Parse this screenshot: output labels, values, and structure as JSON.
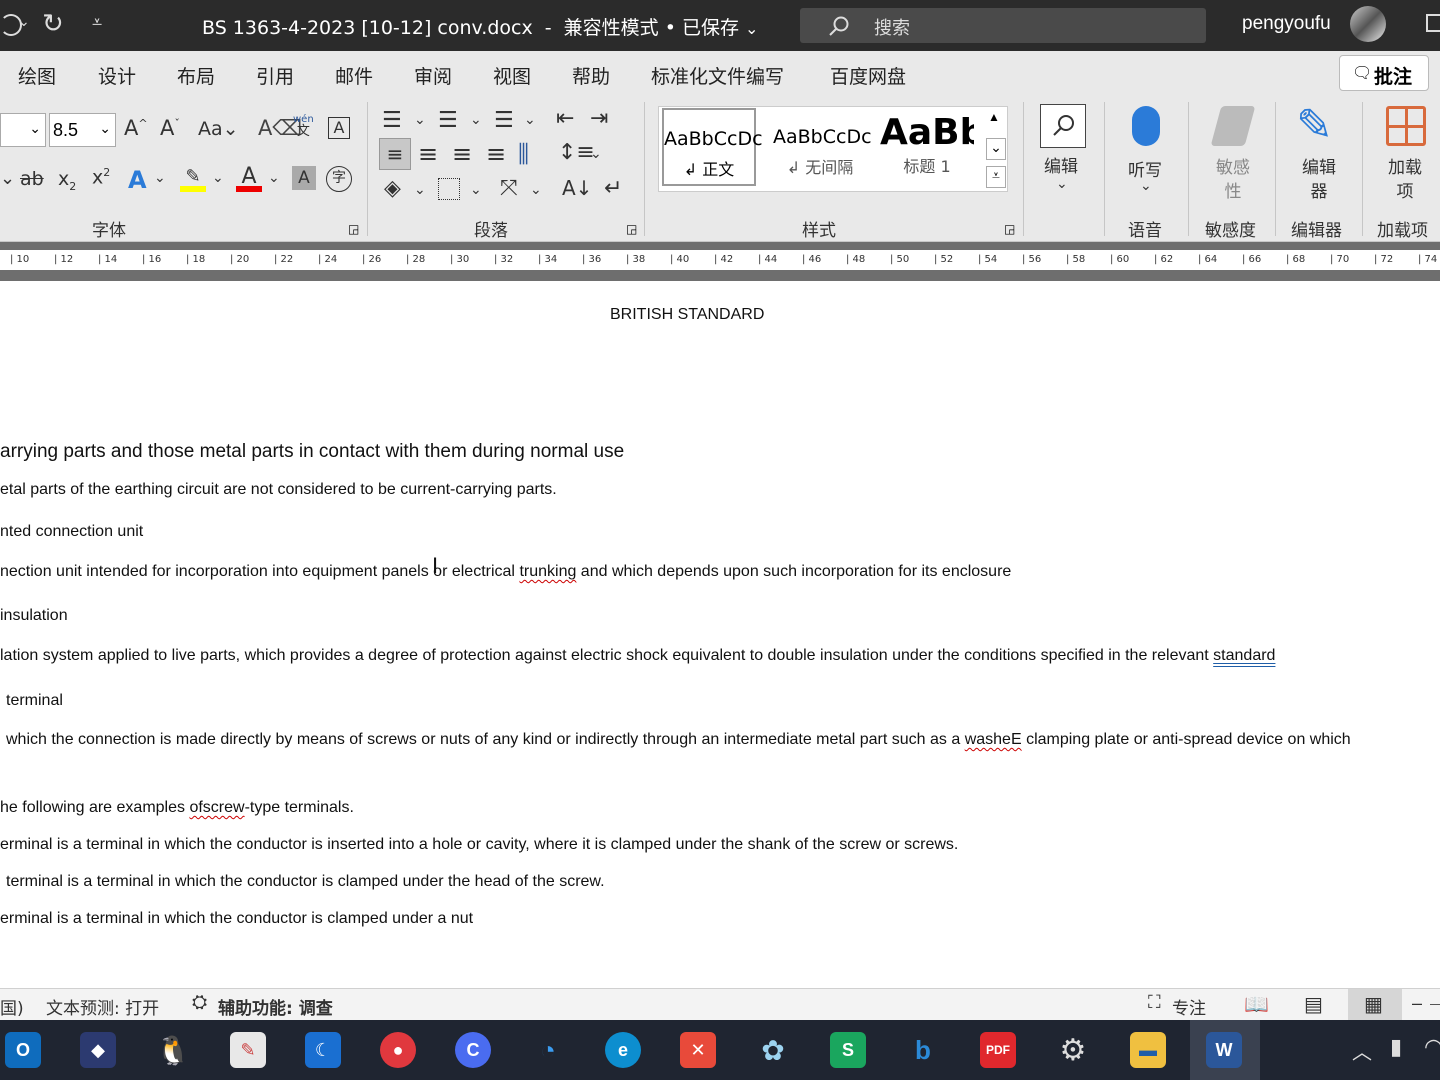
{
  "titlebar": {
    "doc_title": "BS 1363-4-2023 [10-12] conv.docx",
    "dash": "-",
    "mode": "兼容性模式 • 已保存",
    "search_placeholder": "搜索",
    "user": "pengyoufu"
  },
  "tabs": [
    "绘图",
    "设计",
    "布局",
    "引用",
    "邮件",
    "审阅",
    "视图",
    "帮助",
    "标准化文件编写",
    "百度网盘"
  ],
  "comment_button": "批注",
  "ribbon": {
    "font_size": "8.5",
    "wen_label": "wén",
    "wen_char": "文",
    "groups": {
      "font": "字体",
      "paragraph": "段落",
      "styles": "样式",
      "voice": "语音",
      "sensitivity": "敏感度",
      "editor": "编辑器",
      "addins": "加载项"
    },
    "styles": [
      {
        "preview": "AaBbCcDc",
        "name": "正文"
      },
      {
        "preview": "AaBbCcDc",
        "name": "无间隔"
      },
      {
        "preview": "AaBb",
        "name": "标题 1"
      }
    ],
    "edit_label": "编辑",
    "dictate_label": "听写",
    "sensitivity_label": "敏感性",
    "editor_label": "编辑器",
    "addins_label": "加载项"
  },
  "ruler_ticks": [
    "10",
    "12",
    "14",
    "16",
    "18",
    "20",
    "22",
    "24",
    "26",
    "28",
    "30",
    "32",
    "34",
    "36",
    "38",
    "40",
    "42",
    "44",
    "46",
    "48",
    "50",
    "52",
    "54",
    "56",
    "58",
    "60",
    "62",
    "64",
    "66",
    "68",
    "70",
    "72",
    "74"
  ],
  "document": {
    "header": "BRITISH STANDARD",
    "lines": [
      "arrying parts and those metal parts in contact with them during normal use",
      "etal parts of the earthing circuit are not considered to be current-carrying parts.",
      "nted connection unit",
      "nection unit intended for incorporation into equipment panels or electrical trunking and which depends upon such incorporation for its enclosure",
      "insulation",
      "lation system applied to live parts, which provides a degree of protection against electric shock equivalent to double insulation under the conditions specified in the relevant standard",
      "terminal",
      "which the connection is made directly by means of screws or nuts of any kind or indirectly through an intermediate metal part such as a washeE clamping plate or anti-spread device on which",
      "he following are examples ofscrew-type terminals.",
      "erminal is a terminal in which the conductor is inserted into a hole or cavity, where it is clamped under the shank of the screw or screws.",
      "terminal is a terminal in which the conductor is clamped under the head of the screw.",
      "erminal is a terminal in which the conductor is clamped under a nut"
    ]
  },
  "statusbar": {
    "lang": "国)",
    "predict": "文本预测: 打开",
    "accessibility": "辅助功能: 调查",
    "focus": "专注"
  },
  "taskbar_apps": [
    "outlook",
    "app",
    "qq",
    "paint",
    "app",
    "app",
    "app",
    "app",
    "edge",
    "app",
    "app",
    "app",
    "bing",
    "pdf",
    "settings",
    "explorer",
    "word"
  ],
  "colors": {
    "accent": "#2b579a",
    "title_bg": "#2b2b2b",
    "ribbon_bg": "#e9e9e9",
    "taskbar_bg": "#1f2531"
  }
}
